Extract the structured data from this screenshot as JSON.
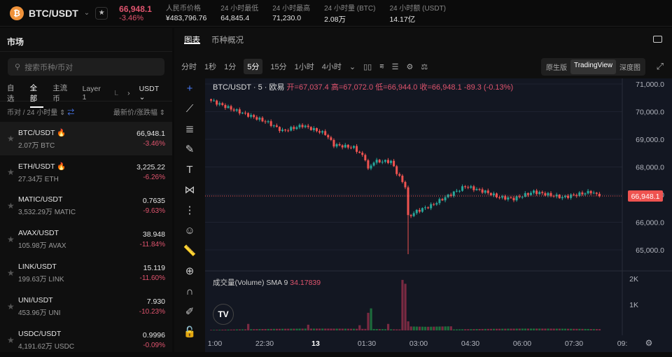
{
  "header": {
    "pair": "BTC/USDT",
    "price": "66,948.1",
    "change": "-3.46%",
    "stats": [
      {
        "label": "人民币价格",
        "value": "¥483,796.76"
      },
      {
        "label": "24 小时最低",
        "value": "64,845.4"
      },
      {
        "label": "24 小时最高",
        "value": "71,230.0"
      },
      {
        "label": "24 小时量 (BTC)",
        "value": "2.08万"
      },
      {
        "label": "24 小时额 (USDT)",
        "value": "14.17亿"
      }
    ]
  },
  "sidebar": {
    "title": "市场",
    "search_placeholder": "搜索币种/币对",
    "tabs": [
      "自选",
      "全部",
      "主流币",
      "Layer 1",
      "L"
    ],
    "quote": "USDT",
    "col_left": "币对 / 24 小时量",
    "col_right": "最新价/涨跌幅",
    "items": [
      {
        "pair": "BTC/USDT",
        "vol": "2.07万 BTC",
        "price": "66,948.1",
        "chg": "-3.46%",
        "hot": true
      },
      {
        "pair": "ETH/USDT",
        "vol": "27.34万 ETH",
        "price": "3,225.22",
        "chg": "-6.26%",
        "hot": true
      },
      {
        "pair": "MATIC/USDT",
        "vol": "3,532.29万 MATIC",
        "price": "0.7635",
        "chg": "-9.63%"
      },
      {
        "pair": "AVAX/USDT",
        "vol": "105.98万 AVAX",
        "price": "38.948",
        "chg": "-11.84%"
      },
      {
        "pair": "LINK/USDT",
        "vol": "199.63万 LINK",
        "price": "15.119",
        "chg": "-11.60%"
      },
      {
        "pair": "UNI/USDT",
        "vol": "453.96万 UNI",
        "price": "7.930",
        "chg": "-10.23%"
      },
      {
        "pair": "USDC/USDT",
        "vol": "4,191.62万 USDC",
        "price": "0.9996",
        "chg": "-0.09%"
      }
    ]
  },
  "main": {
    "tabs": [
      "图表",
      "币种概况"
    ],
    "intervals": [
      "分时",
      "1秒",
      "1分",
      "5分",
      "15分",
      "1小时",
      "4小时"
    ],
    "active_interval": "5分",
    "views": [
      "原生版",
      "TradingView",
      "深度图"
    ],
    "active_view": "TradingView"
  },
  "legend": {
    "title": "BTC/USDT · 5 · 欧易",
    "open": "开=67,037.4",
    "high": "高=67,072.0",
    "low": "低=66,944.0",
    "close": "收=66,948.1",
    "change": "-89.3 (-0.13%)"
  },
  "volume_legend": {
    "label": "成交量(Volume) SMA 9",
    "value": "34.17839"
  },
  "colors": {
    "up": "#26a69a",
    "down": "#ef5350",
    "vol_up": "#1e6b3c",
    "vol_down": "#7a2a42"
  },
  "chart_data": {
    "type": "candlestick",
    "price_ticks": [
      71000,
      70000,
      69000,
      68000,
      67000,
      66000,
      65000
    ],
    "price_tick_labels": [
      "71,000.0",
      "70,000.0",
      "69,000.0",
      "68,000.0",
      "67,000.0",
      "66,000.0",
      "65,000.0"
    ],
    "last_price": 66948.1,
    "last_price_label": "66,948.1",
    "vol_ticks": [
      "2K",
      "1K"
    ],
    "time_labels": [
      "1:00",
      "22:30",
      "13",
      "01:30",
      "03:00",
      "04:30",
      "06:00",
      "07:30",
      "09:"
    ],
    "path": [
      [
        0,
        70400
      ],
      [
        7,
        70100
      ],
      [
        15,
        69800
      ],
      [
        20,
        69600
      ],
      [
        25,
        69300
      ],
      [
        32,
        69500
      ],
      [
        40,
        69200
      ],
      [
        43,
        68800
      ],
      [
        50,
        68700
      ],
      [
        54,
        68300
      ],
      [
        55,
        67900
      ],
      [
        57,
        68200
      ],
      [
        63,
        68200
      ],
      [
        65,
        67800
      ],
      [
        68,
        67300
      ],
      [
        69,
        66200
      ],
      [
        72,
        66400
      ],
      [
        77,
        66600
      ],
      [
        82,
        66900
      ],
      [
        89,
        67300
      ],
      [
        96,
        67100
      ],
      [
        101,
        66900
      ],
      [
        106,
        66850
      ],
      [
        113,
        67100
      ],
      [
        123,
        66900
      ],
      [
        133,
        67100
      ],
      [
        136,
        66948
      ]
    ],
    "volume_spikes": [
      [
        55,
        680
      ],
      [
        56,
        850
      ],
      [
        67,
        1950
      ],
      [
        68,
        1800
      ],
      [
        69,
        350
      ],
      [
        62,
        250
      ],
      [
        52,
        200
      ],
      [
        13,
        250
      ],
      [
        34,
        220
      ]
    ]
  }
}
